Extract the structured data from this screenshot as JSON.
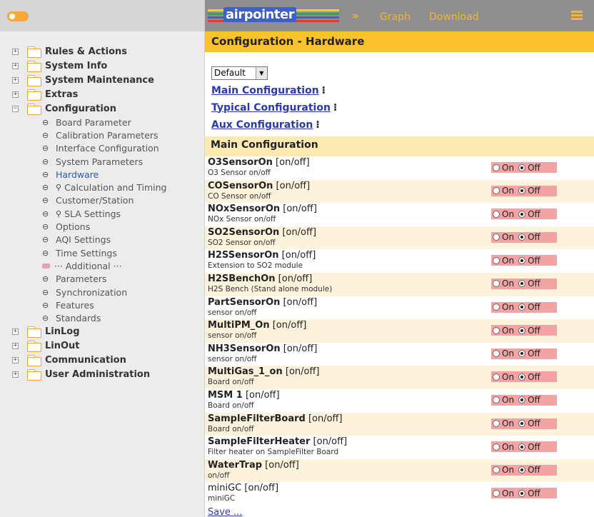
{
  "sidebar": {
    "folders_top": [
      {
        "label": "Rules & Actions",
        "toggle": "⊞"
      },
      {
        "label": "System Info",
        "toggle": "⊞"
      },
      {
        "label": "System Maintenance",
        "toggle": "⊞"
      },
      {
        "label": "Extras",
        "toggle": "⊞"
      },
      {
        "label": "Configuration",
        "toggle": "⊟"
      }
    ],
    "children": [
      {
        "label": "Board Parameter"
      },
      {
        "label": "Calibration Parameters"
      },
      {
        "label": "Interface Configuration"
      },
      {
        "label": "System Parameters"
      },
      {
        "label": "Hardware"
      },
      {
        "label": "Calculation and Timing"
      },
      {
        "label": "Customer/Station"
      },
      {
        "label": "SLA Settings"
      },
      {
        "label": "Options"
      },
      {
        "label": "AQI Settings"
      },
      {
        "label": "Time Settings"
      },
      {
        "label": "··· Additional ···"
      },
      {
        "label": "Parameters"
      },
      {
        "label": "Synchronization"
      },
      {
        "label": "Features"
      },
      {
        "label": "Standards"
      }
    ],
    "folders_bottom": [
      {
        "label": "LinLog",
        "toggle": "⊞"
      },
      {
        "label": "LinOut",
        "toggle": "⊞"
      },
      {
        "label": "Communication",
        "toggle": "⊞"
      },
      {
        "label": "User Administration",
        "toggle": "⊞"
      }
    ]
  },
  "header": {
    "logo": "airpointer",
    "chevron": "»",
    "graph_link": "Graph",
    "download_link": "Download"
  },
  "page": {
    "title": "Configuration - Hardware",
    "select_value": "Default",
    "select_arrow": "▼",
    "links": [
      "Main Configuration",
      "Typical Configuration",
      "Aux Configuration"
    ],
    "link_dots": "⁝",
    "section_title": "Main Configuration",
    "on_label": "On",
    "off_label": "Off",
    "save_label": "Save ..."
  },
  "rows": [
    {
      "name": "O3SensorOn",
      "suffix": " [on/off]",
      "desc": "O3 Sensor on/off"
    },
    {
      "name": "COSensorOn",
      "suffix": " [on/off]",
      "desc": "CO Sensor on/off"
    },
    {
      "name": "NOxSensorOn",
      "suffix": " [on/off]",
      "desc": "NOx Sensor on/off"
    },
    {
      "name": "SO2SensorOn",
      "suffix": " [on/off]",
      "desc": "SO2 Sensor on/off"
    },
    {
      "name": "H2SSensorOn",
      "suffix": " [on/off]",
      "desc": "Extension to SO2 module"
    },
    {
      "name": "H2SBenchOn",
      "suffix": " [on/off]",
      "desc": "H2S Bench (Stand alone module)"
    },
    {
      "name": "PartSensorOn",
      "suffix": " [on/off]",
      "desc": "sensor on/off"
    },
    {
      "name": "MultiPM_On",
      "suffix": " [on/off]",
      "desc": "sensor on/off"
    },
    {
      "name": "NH3SensorOn",
      "suffix": " [on/off]",
      "desc": "sensor on/off"
    },
    {
      "name": "MultiGas_1_on",
      "suffix": " [on/off]",
      "desc": "Board on/off"
    },
    {
      "name": "MSM 1",
      "suffix": " [on/off]",
      "desc": "Board on/off"
    },
    {
      "name": "SampleFilterBoard",
      "suffix": " [on/off]",
      "desc": "Board on/off"
    },
    {
      "name": "SampleFilterHeater",
      "suffix": " [on/off]",
      "desc": "Filter heater on SampleFilter Board"
    },
    {
      "name": "WaterTrap",
      "suffix": " [on/off]",
      "desc": "on/off"
    },
    {
      "name": "miniGC",
      "suffix": " [on/off]",
      "desc": "miniGC",
      "bold": false
    }
  ],
  "colors": {
    "accent": "#fac22c",
    "link": "#2a3aa8",
    "radio_bg": "#f2a4a4"
  }
}
